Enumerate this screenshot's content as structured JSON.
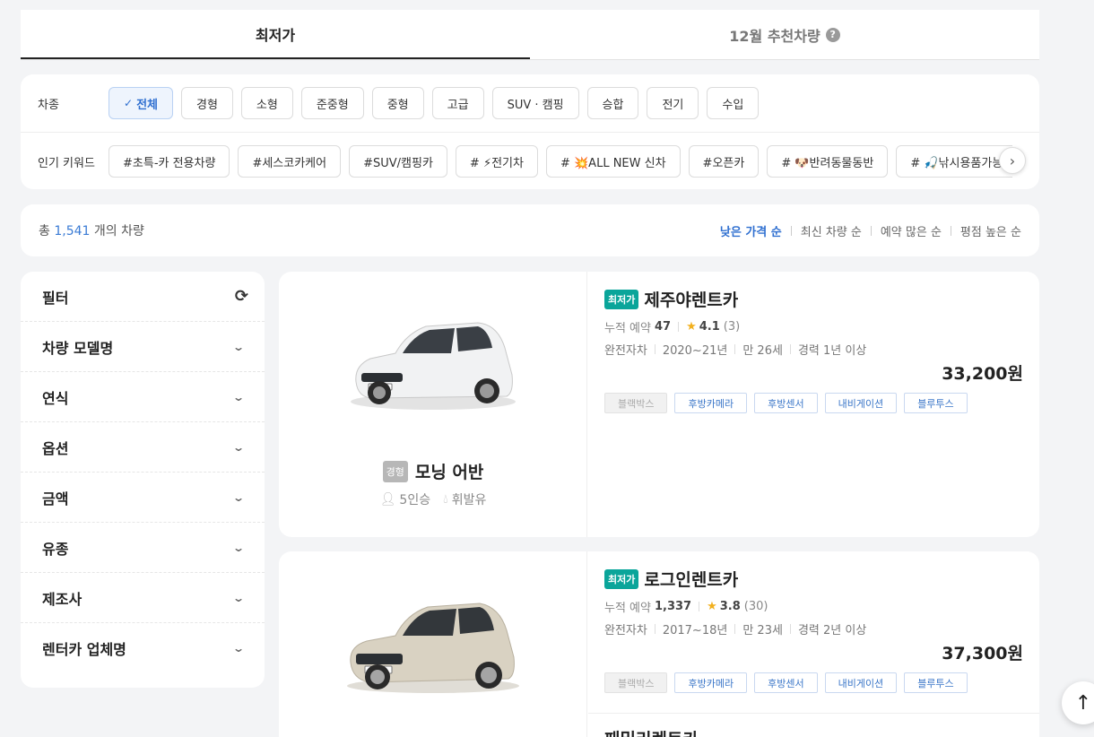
{
  "tabs": [
    {
      "label": "최저가"
    },
    {
      "label": "12월 추천차량",
      "help_icon": "question-icon"
    }
  ],
  "category": {
    "label": "차종",
    "items": [
      "전체",
      "경형",
      "소형",
      "준중형",
      "중형",
      "고급",
      "SUV · 캠핑",
      "승합",
      "전기",
      "수입"
    ],
    "selected": "전체"
  },
  "keywords": {
    "label": "인기 키워드",
    "items": [
      "#초특-카 전용차량",
      "#세스코카케어",
      "#SUV/캠핑카",
      "# ⚡전기차",
      "# 💥ALL NEW 신차",
      "#오픈카",
      "# 🐶반려동물동반",
      "# 🎣낚시용품가능"
    ]
  },
  "results": {
    "prefix": "총",
    "count": "1,541",
    "suffix": "개의 차량",
    "sorts": [
      "낮은 가격 순",
      "최신 차량 순",
      "예약 많은 순",
      "평점 높은 순"
    ],
    "active_sort": "낮은 가격 순"
  },
  "filter": {
    "title": "필터",
    "items": [
      "차량 모델명",
      "연식",
      "옵션",
      "금액",
      "유종",
      "제조사",
      "렌터카 업체명"
    ]
  },
  "cars": [
    {
      "type": "경형",
      "name": "모닝 어반",
      "seats": "5인승",
      "fuel": "휘발유",
      "color": "white",
      "offers": [
        {
          "badge": "최저가",
          "company": "제주야렌트카",
          "reservations_label": "누적 예약",
          "reservations": "47",
          "rating": "4.1",
          "reviews": "(3)",
          "insurance": "완전자차",
          "years": "2020~21년",
          "age": "만 26세",
          "experience": "경력 1년 이상",
          "price": "33,200원",
          "options": [
            {
              "label": "블랙박스",
              "on": false
            },
            {
              "label": "후방카메라",
              "on": true
            },
            {
              "label": "후방센서",
              "on": true
            },
            {
              "label": "내비게이션",
              "on": true
            },
            {
              "label": "블루투스",
              "on": true
            }
          ]
        }
      ]
    },
    {
      "color": "beige",
      "offers": [
        {
          "badge": "최저가",
          "company": "로그인렌트카",
          "reservations_label": "누적 예약",
          "reservations": "1,337",
          "rating": "3.8",
          "reviews": "(30)",
          "insurance": "완전자차",
          "years": "2017~18년",
          "age": "만 23세",
          "experience": "경력 2년 이상",
          "price": "37,300원",
          "options": [
            {
              "label": "블랙박스",
              "on": false
            },
            {
              "label": "후방카메라",
              "on": true
            },
            {
              "label": "후방센서",
              "on": true
            },
            {
              "label": "내비게이션",
              "on": true
            },
            {
              "label": "블루투스",
              "on": true
            }
          ]
        },
        {
          "company": "패밀리렌트카"
        }
      ]
    }
  ]
}
